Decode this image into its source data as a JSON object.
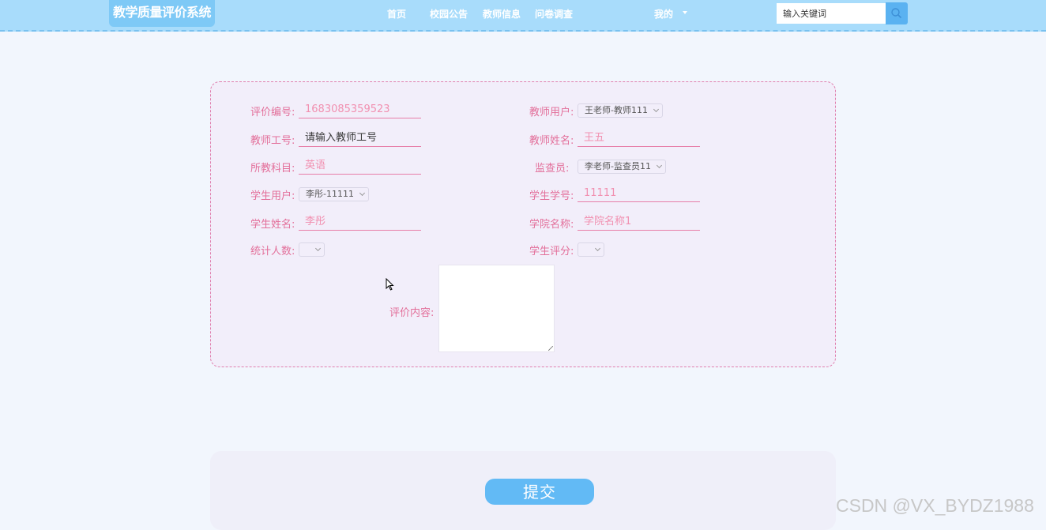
{
  "header": {
    "brand": "教学质量评价系统",
    "nav": [
      "首页",
      "校园公告",
      "教师信息",
      "问卷调查"
    ],
    "user_menu": "我的",
    "search_placeholder": "输入关键词"
  },
  "form": {
    "eval_no": {
      "label": "评价编号:",
      "value": "1683085359523"
    },
    "teacher_user": {
      "label": "教师用户:",
      "value": "王老师-教师111"
    },
    "teacher_no": {
      "label": "教师工号:",
      "placeholder": "请输入教师工号"
    },
    "teacher_name": {
      "label": "教师姓名:",
      "value": "王五"
    },
    "subject": {
      "label": "所教科目:",
      "value": "英语"
    },
    "supervisor": {
      "label": "监查员:",
      "value": "李老师-监查员11"
    },
    "student_user": {
      "label": "学生用户:",
      "value": "李彤-11111"
    },
    "student_no": {
      "label": "学生学号:",
      "value": "11111"
    },
    "student_name": {
      "label": "学生姓名:",
      "value": "李彤"
    },
    "college": {
      "label": "学院名称:",
      "value": "学院名称1"
    },
    "count": {
      "label": "统计人数:",
      "value": ""
    },
    "score": {
      "label": "学生评分:",
      "value": ""
    },
    "content": {
      "label": "评价内容:",
      "value": ""
    }
  },
  "submit_label": "提交",
  "watermark": "CSDN @VX_BYDZ1988",
  "colors": {
    "nav_bg": "#a8dcfb",
    "label": "#e36f9a",
    "button": "#62baf5"
  },
  "icons": [
    "search-icon",
    "chevron-down-icon",
    "cursor-icon"
  ]
}
